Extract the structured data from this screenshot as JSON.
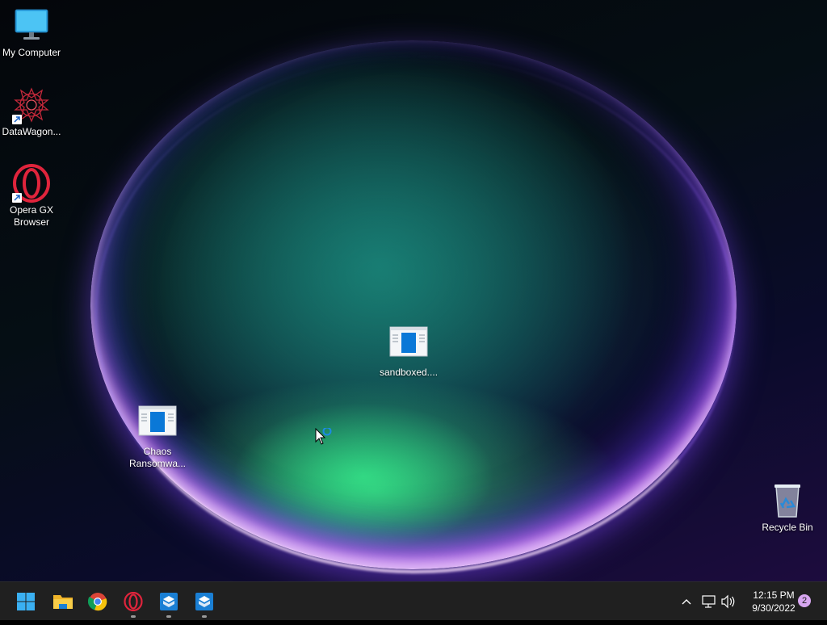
{
  "desktop": {
    "icons": [
      {
        "label": "My Computer",
        "icon": "monitor-icon"
      },
      {
        "label": "DataWagon...",
        "icon": "datawagon-app-icon"
      },
      {
        "label": "Opera GX Browser",
        "icon": "opera-gx-icon"
      },
      {
        "label": "sandboxed....",
        "icon": "application-window-icon"
      },
      {
        "label": "Chaos Ransomwa...",
        "icon": "application-window-icon"
      },
      {
        "label": "Recycle Bin",
        "icon": "recycle-bin-icon"
      }
    ]
  },
  "taskbar": {
    "buttons": [
      {
        "name": "start",
        "icon": "windows-start-icon"
      },
      {
        "name": "file-explorer",
        "icon": "folder-icon"
      },
      {
        "name": "chrome",
        "icon": "chrome-icon"
      },
      {
        "name": "opera-gx",
        "icon": "opera-gx-icon",
        "running": true
      },
      {
        "name": "sandbox-app-1",
        "icon": "sandbox-box-icon",
        "running": true
      },
      {
        "name": "sandbox-app-2",
        "icon": "sandbox-box-icon",
        "running": true
      }
    ],
    "tray": {
      "time": "12:15 PM",
      "date": "9/30/2022",
      "notification_count": "2"
    }
  },
  "colors": {
    "taskbar_bg": "#202020",
    "accent_blue": "#0a78d7",
    "opera_red": "#e0243c",
    "notification_badge": "#d7a6f0"
  }
}
